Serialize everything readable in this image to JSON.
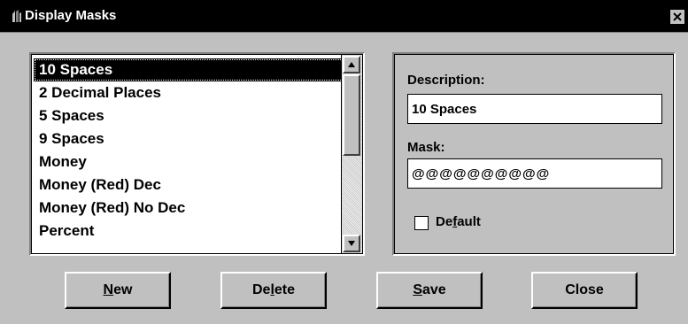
{
  "window": {
    "title": "Display Masks",
    "close_glyph": "X",
    "icon": "app-icon"
  },
  "list": {
    "items": [
      "10 Spaces",
      "2 Decimal Places",
      "5 Spaces",
      "9 Spaces",
      "Money",
      "Money (Red) Dec",
      "Money (Red) No Dec",
      "Percent"
    ],
    "selected_index": 0
  },
  "details": {
    "description_label": "Description:",
    "description_value": "10 Spaces",
    "mask_label": "Mask:",
    "mask_value": "@@@@@@@@@@",
    "default_label": {
      "before": "De",
      "accel": "f",
      "after": "ault"
    },
    "default_checked": false
  },
  "buttons": {
    "new": {
      "before": "",
      "accel": "N",
      "after": "ew"
    },
    "delete": {
      "before": "De",
      "accel": "l",
      "after": "ete"
    },
    "save": {
      "before": "",
      "accel": "S",
      "after": "ave"
    },
    "close": {
      "before": "",
      "accel": "",
      "after": "Close"
    }
  },
  "colors": {
    "face": "#c0c0c0",
    "titlebar": "#000000",
    "selection": "#000000",
    "field": "#ffffff"
  }
}
